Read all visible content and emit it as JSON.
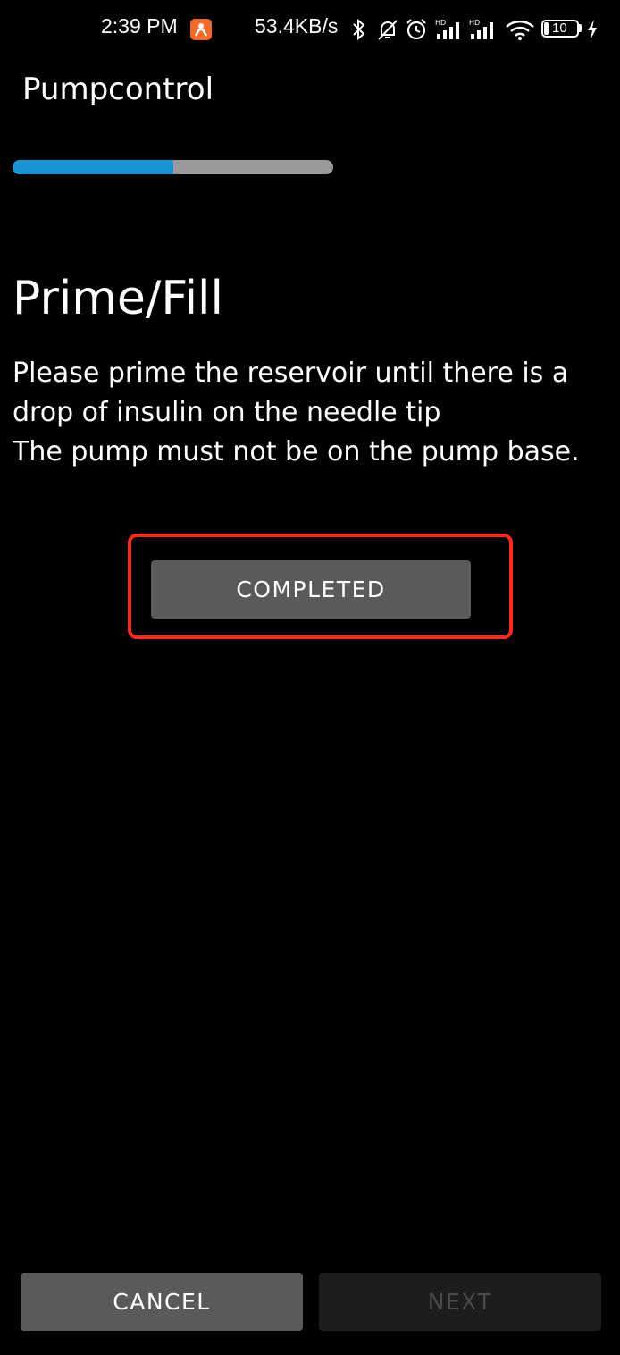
{
  "status_bar": {
    "time": "2:39 PM",
    "network_speed": "53.4KB/s",
    "battery_level": "10",
    "icons": [
      "app-notification-icon",
      "bluetooth-icon",
      "silent-bell-icon",
      "alarm-icon",
      "signal-hd-icon",
      "signal-hd-icon",
      "wifi-icon",
      "battery-icon",
      "charging-icon"
    ]
  },
  "app_bar": {
    "title": "Pumpcontrol"
  },
  "progress": {
    "value": 0.5
  },
  "step": {
    "title": "Prime/Fill",
    "description_lines": [
      "Please prime the reservoir until there is a",
      "drop of insulin on the needle tip",
      "The pump must not be on the pump base."
    ],
    "completed_label": "COMPLETED"
  },
  "footer": {
    "cancel_label": "CANCEL",
    "next_label": "NEXT"
  },
  "colors": {
    "background": "#000000",
    "progress_fill": "#1a96d4",
    "progress_track": "#9a9a9a",
    "button": "#5a5a5a",
    "button_disabled": "#1d1d1d",
    "highlight": "#ff2a1a"
  }
}
